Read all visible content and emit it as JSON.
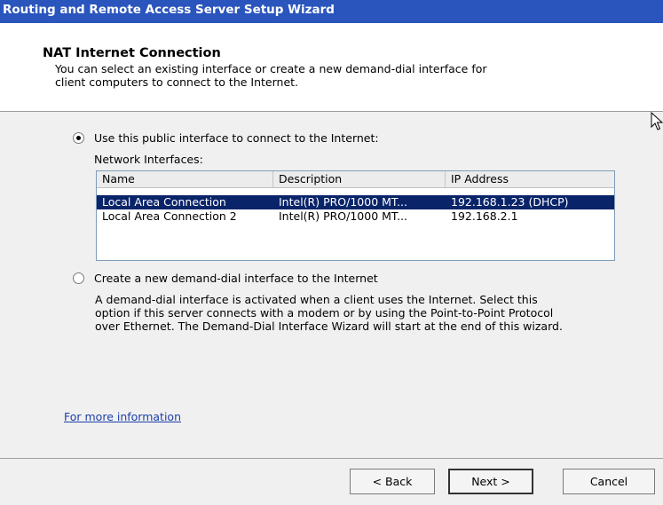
{
  "window": {
    "title": "Routing and Remote Access Server Setup Wizard"
  },
  "header": {
    "heading": "NAT Internet Connection",
    "subtitle_line1": "You can select an existing interface or create a new demand-dial interface for",
    "subtitle_line2": "client computers to connect to the Internet."
  },
  "options": {
    "public": {
      "label": "Use this public interface to connect to the Internet:",
      "selected": true
    },
    "demand_dial": {
      "label": "Create a new demand-dial interface to the Internet",
      "selected": false
    }
  },
  "interfaces": {
    "label": "Network Interfaces:",
    "columns": [
      "Name",
      "Description",
      "IP Address"
    ],
    "rows": [
      {
        "name": "Local Area Connection",
        "description": "Intel(R) PRO/1000 MT...",
        "ip": "192.168.1.23 (DHCP)",
        "selected": true
      },
      {
        "name": "Local Area Connection 2",
        "description": "Intel(R) PRO/1000 MT...",
        "ip": "192.168.2.1",
        "selected": false
      }
    ]
  },
  "demand_dial_description": {
    "line1": "A demand-dial interface is activated when a client uses the Internet. Select this",
    "line2": "option if this server connects with a modem or by using the Point-to-Point Protocol",
    "line3": "over Ethernet. The Demand-Dial Interface Wizard will start at the end of this wizard."
  },
  "more_info_link": "For more information",
  "buttons": {
    "back": "< Back",
    "next": "Next >",
    "cancel": "Cancel"
  },
  "colors": {
    "titlebar": "#2a55bd",
    "selection": "#0a246a",
    "link": "#1a3fa8",
    "panel": "#f0f0f0"
  },
  "icons": {
    "cursor": "mouse-pointer-icon"
  }
}
